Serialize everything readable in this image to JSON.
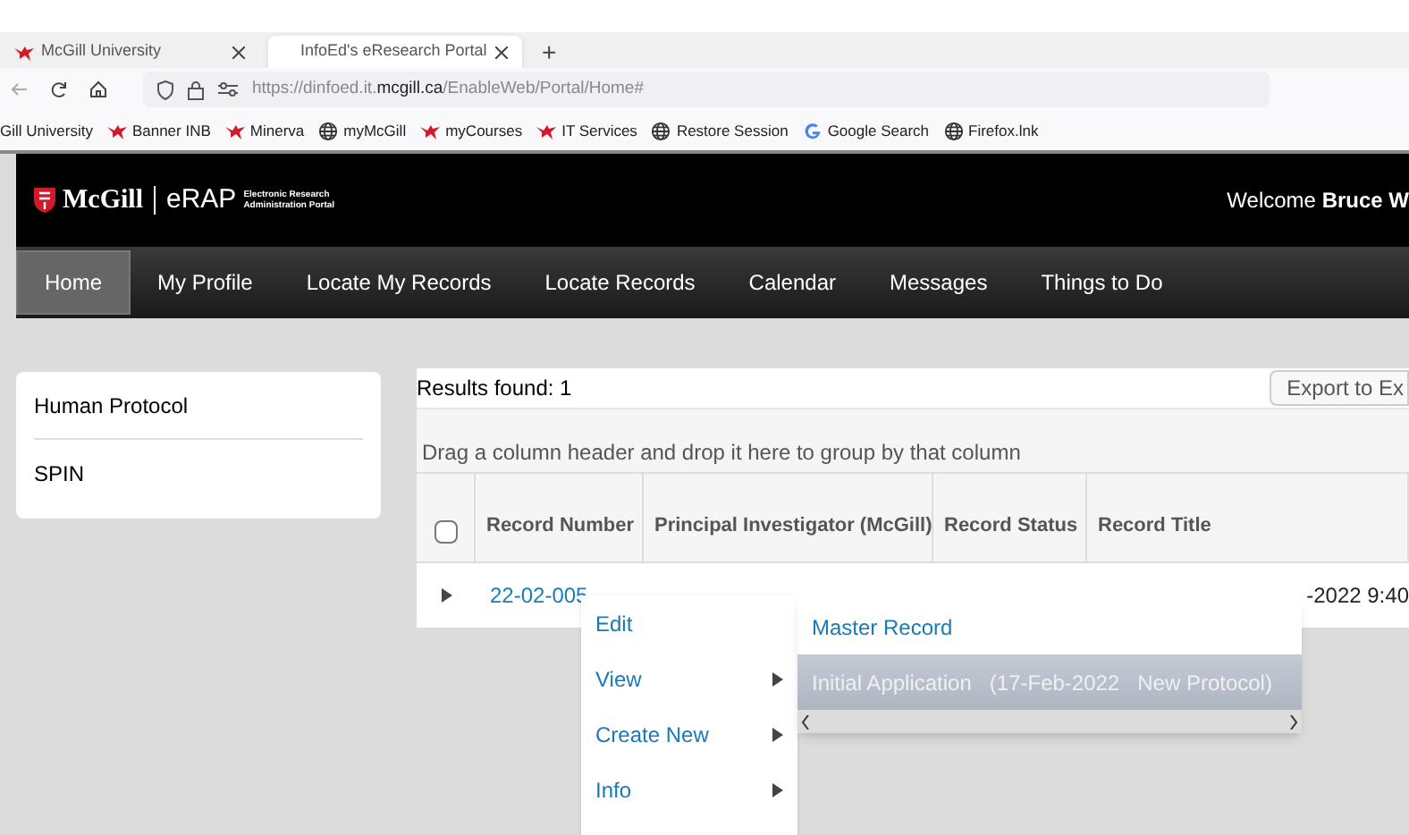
{
  "browser": {
    "tabs": [
      {
        "title": "McGill University",
        "selected": false
      },
      {
        "title": "InfoEd's eResearch Portal",
        "selected": true
      }
    ],
    "new_tab": "+",
    "url": "https://dinfoed.it.**mcgill.ca**/EnableWeb/Portal/Home#",
    "bookmarks": [
      {
        "label": "Gill University",
        "kind": "none"
      },
      {
        "label": "Banner INB",
        "kind": "martlet"
      },
      {
        "label": "Minerva",
        "kind": "martlet"
      },
      {
        "label": "myMcGill",
        "kind": "globe"
      },
      {
        "label": "myCourses",
        "kind": "martlet"
      },
      {
        "label": "IT Services",
        "kind": "martlet"
      },
      {
        "label": "Restore Session",
        "kind": "globe"
      },
      {
        "label": "Google Search",
        "kind": "google"
      },
      {
        "label": "Firefox.lnk",
        "kind": "globe"
      }
    ]
  },
  "header": {
    "logo_name": "McGill",
    "app_name": "eRAP",
    "app_subtitle": [
      "Electronic Research",
      "Administration Portal"
    ],
    "welcome": "Welcome **Bruce W**"
  },
  "nav": [
    {
      "label": "Home",
      "selected": true
    },
    {
      "label": "My Profile",
      "selected": false
    },
    {
      "label": "Locate My Records",
      "selected": false
    },
    {
      "label": "Locate Records",
      "selected": false
    },
    {
      "label": "Calendar",
      "selected": false
    },
    {
      "label": "Messages",
      "selected": false
    },
    {
      "label": "Things to Do",
      "selected": false
    }
  ],
  "sidebar": {
    "items": [
      "Human Protocol",
      "SPIN"
    ]
  },
  "results": {
    "count_text": "Results found: 1",
    "export_button": "Export to Ex",
    "group_hint": "Drag a column header and drop it here to group by that column",
    "select_all_checked": false,
    "columns": [
      "Record Number",
      "Principal Investigator (McGill)",
      "Record Status",
      "Record Title"
    ],
    "rows": [
      {
        "record_number": "22-02-005",
        "expanded": false,
        "column_5": "-2022 9:40"
      }
    ]
  },
  "context_menu": {
    "items": [
      {
        "label": "Edit",
        "has_submenu": false
      },
      {
        "label": "View",
        "has_submenu": true
      },
      {
        "label": "Create New",
        "has_submenu": true
      },
      {
        "label": "Info",
        "has_submenu": true
      }
    ],
    "submenu": [
      {
        "label": "Master Record",
        "selected": false
      },
      {
        "label": "Initial Application   (17-Feb-2022   New Protocol)",
        "selected": true
      }
    ]
  }
}
